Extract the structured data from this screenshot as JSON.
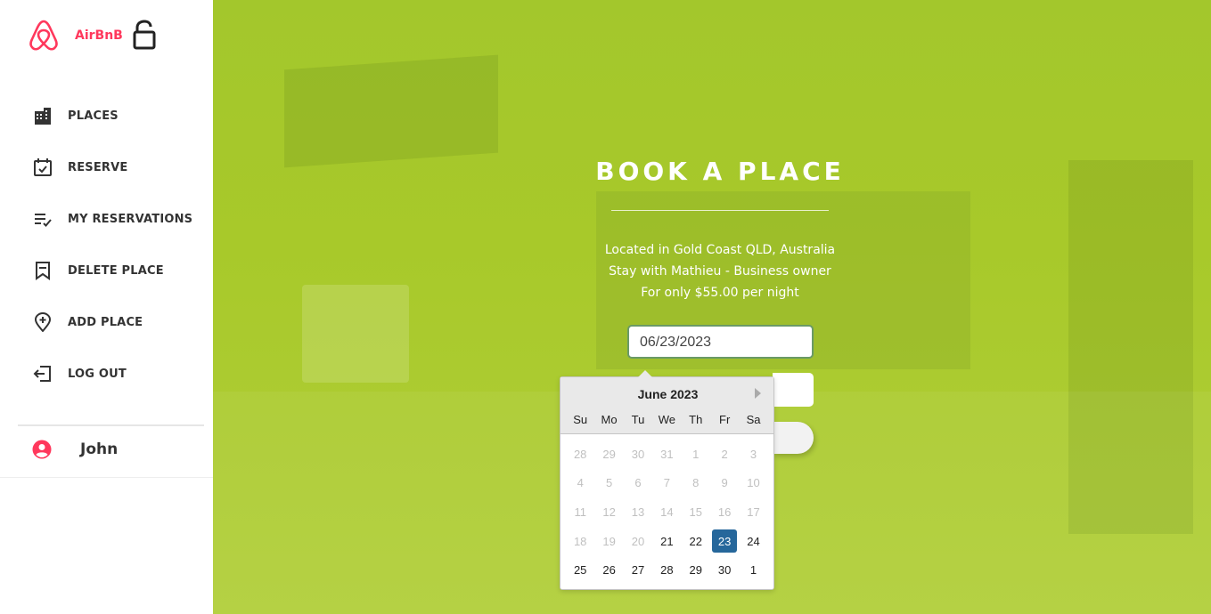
{
  "brand": {
    "name": "AirBnB",
    "accent": "#ff385c"
  },
  "sidebar": {
    "items": [
      {
        "label": "PLACES",
        "icon": "building-icon"
      },
      {
        "label": "RESERVE",
        "icon": "calendar-check-icon"
      },
      {
        "label": "MY RESERVATIONS",
        "icon": "list-check-icon"
      },
      {
        "label": "DELETE PLACE",
        "icon": "bookmark-icon"
      },
      {
        "label": "ADD PLACE",
        "icon": "location-plus-icon"
      },
      {
        "label": "LOG OUT",
        "icon": "logout-icon"
      }
    ],
    "user": {
      "name": "John",
      "icon": "user-circle-icon"
    }
  },
  "main": {
    "title": "BOOK A PLACE",
    "lines": [
      "Located in Gold Coast QLD, Australia",
      "Stay with Mathieu - Business owner",
      "For only $55.00 per night"
    ],
    "date_value": "06/23/2023",
    "background_color": "#a3c72c"
  },
  "datepicker": {
    "month_label": "June 2023",
    "weekdays": [
      "Su",
      "Mo",
      "Tu",
      "We",
      "Th",
      "Fr",
      "Sa"
    ],
    "weeks": [
      [
        [
          "28",
          true
        ],
        [
          "29",
          true
        ],
        [
          "30",
          true
        ],
        [
          "31",
          true
        ],
        [
          "1",
          true
        ],
        [
          "2",
          true
        ],
        [
          "3",
          true
        ]
      ],
      [
        [
          "4",
          true
        ],
        [
          "5",
          true
        ],
        [
          "6",
          true
        ],
        [
          "7",
          true
        ],
        [
          "8",
          true
        ],
        [
          "9",
          true
        ],
        [
          "10",
          true
        ]
      ],
      [
        [
          "11",
          true
        ],
        [
          "12",
          true
        ],
        [
          "13",
          true
        ],
        [
          "14",
          true
        ],
        [
          "15",
          true
        ],
        [
          "16",
          true
        ],
        [
          "17",
          true
        ]
      ],
      [
        [
          "18",
          true
        ],
        [
          "19",
          true
        ],
        [
          "20",
          true
        ],
        [
          "21",
          false
        ],
        [
          "22",
          false
        ],
        [
          "23",
          false
        ],
        [
          "24",
          false
        ]
      ],
      [
        [
          "25",
          false
        ],
        [
          "26",
          false
        ],
        [
          "27",
          false
        ],
        [
          "28",
          false
        ],
        [
          "29",
          false
        ],
        [
          "30",
          false
        ],
        [
          "1",
          false
        ]
      ]
    ],
    "selected": "23",
    "selected_color": "#26679b"
  }
}
